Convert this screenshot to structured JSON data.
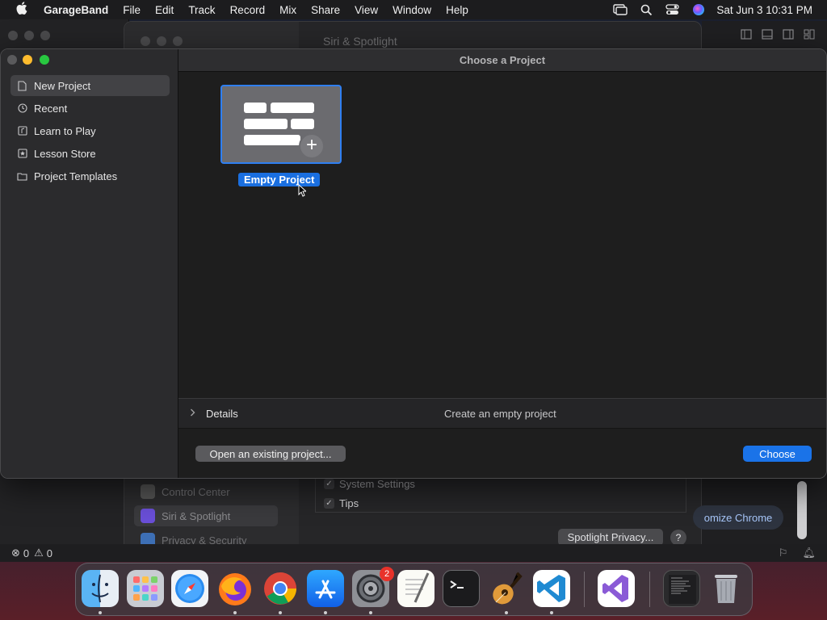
{
  "menubar": {
    "app_name": "GarageBand",
    "menus": [
      "File",
      "Edit",
      "Track",
      "Record",
      "Mix",
      "Share",
      "View",
      "Window",
      "Help"
    ],
    "clock": "Sat Jun 3  10:31 PM",
    "status_icons": [
      "screen-mirroring-icon",
      "search-icon",
      "control-center-icon",
      "siri-icon"
    ]
  },
  "background": {
    "settings_title": "Siri & Spotlight",
    "settings_sidebar": [
      "Control Center",
      "Siri & Spotlight",
      "Privacy & Security"
    ],
    "checklist": [
      "System Settings",
      "Tips"
    ],
    "spotlight_privacy_label": "Spotlight Privacy...",
    "help_label": "?",
    "chrome_button": "omize Chrome",
    "status_errors": "0",
    "status_warnings": "0"
  },
  "dialog": {
    "title": "Choose a Project",
    "sidebar": [
      {
        "label": "New Project",
        "icon": "document-icon",
        "selected": true
      },
      {
        "label": "Recent",
        "icon": "clock-icon",
        "selected": false
      },
      {
        "label": "Learn to Play",
        "icon": "music-icon",
        "selected": false
      },
      {
        "label": "Lesson Store",
        "icon": "star-icon",
        "selected": false
      },
      {
        "label": "Project Templates",
        "icon": "folder-icon",
        "selected": false
      }
    ],
    "project_tile": {
      "label": "Empty Project"
    },
    "details": {
      "label": "Details",
      "description": "Create an empty project"
    },
    "open_existing_label": "Open an existing project...",
    "choose_label": "Choose",
    "accent": "#1a73e8"
  },
  "dock": {
    "apps": [
      "Finder",
      "Launchpad",
      "Safari",
      "Firefox",
      "Chrome",
      "App Store",
      "System Settings",
      "TextEdit",
      "Terminal",
      "GarageBand",
      "Visual Studio Code",
      "Visual Studio",
      "Preview",
      "Trash"
    ],
    "settings_badge": "2"
  }
}
